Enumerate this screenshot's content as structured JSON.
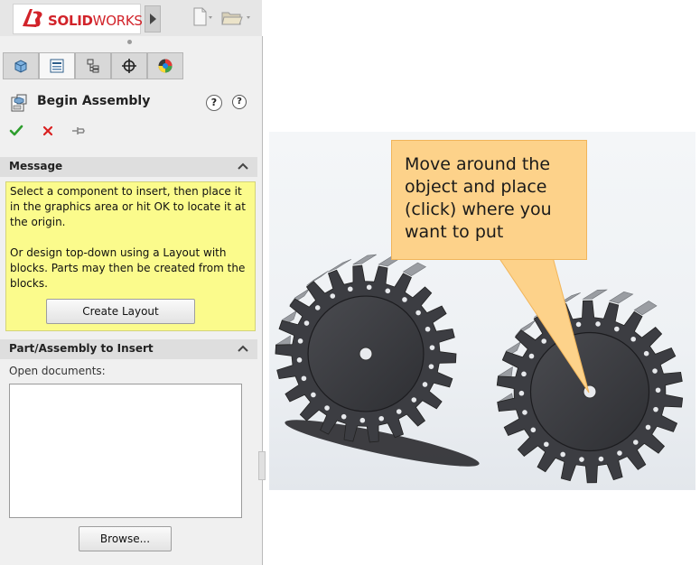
{
  "app": {
    "logo_brand": "SOLID",
    "logo_brand_2": "WORKS"
  },
  "property_manager": {
    "title": "Begin Assembly",
    "help_primary": "?",
    "help_secondary": "?",
    "actions": [
      "ok",
      "cancel",
      "pushpin"
    ]
  },
  "message_section": {
    "header": "Message",
    "line1": "Select a component to insert, then place it in the graphics area or hit OK to locate it at the origin.",
    "line2": "Or design top-down using a Layout with blocks. Parts may then be created from the blocks.",
    "create_layout_label": "Create Layout"
  },
  "insert_section": {
    "header": "Part/Assembly to Insert",
    "open_documents_label": "Open documents:",
    "browse_label": "Browse..."
  },
  "callout": {
    "text": "Move around the object and place (click) where you want to put"
  },
  "colors": {
    "message_bg": "#fbfb8c",
    "callout_bg": "#fdd28a",
    "brand_red": "#d2232a",
    "gear": "#3c3d42",
    "tooth_top": "#9a9da2"
  }
}
